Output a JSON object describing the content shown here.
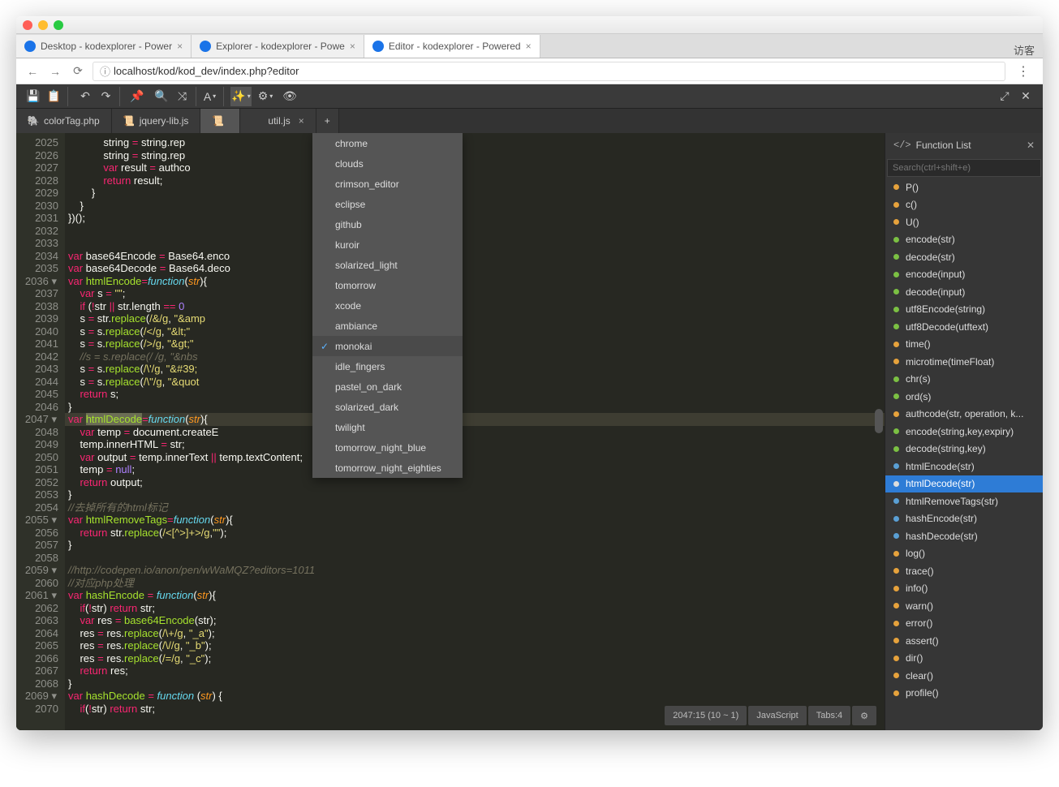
{
  "browser": {
    "tabs": [
      {
        "title": "Desktop - kodexplorer - Power"
      },
      {
        "title": "Explorer - kodexplorer - Powe"
      },
      {
        "title": "Editor - kodexplorer - Powered",
        "active": true
      }
    ],
    "guest": "访客",
    "url": "localhost/kod/kod_dev/index.php?editor"
  },
  "file_tabs": [
    {
      "name": "colorTag.php",
      "icon": "php"
    },
    {
      "name": "jquery-lib.js",
      "icon": "js"
    },
    {
      "name": "",
      "icon": "js",
      "active": true,
      "closable": false
    },
    {
      "name": "util.js",
      "icon": "",
      "closable": true
    }
  ],
  "themes": [
    {
      "name": "chrome"
    },
    {
      "name": "clouds"
    },
    {
      "name": "crimson_editor"
    },
    {
      "name": "eclipse"
    },
    {
      "name": "github"
    },
    {
      "name": "kuroir"
    },
    {
      "name": "solarized_light"
    },
    {
      "name": "tomorrow"
    },
    {
      "name": "xcode"
    },
    {
      "name": "ambiance"
    },
    {
      "name": "monokai",
      "selected": true
    },
    {
      "name": "idle_fingers"
    },
    {
      "name": "pastel_on_dark"
    },
    {
      "name": "solarized_dark"
    },
    {
      "name": "twilight"
    },
    {
      "name": "tomorrow_night_blue"
    },
    {
      "name": "tomorrow_night_eighties"
    }
  ],
  "sidebar": {
    "title": "Function List",
    "search_placeholder": "Search(ctrl+shift+e)",
    "items": [
      {
        "label": "P()",
        "color": "orange"
      },
      {
        "label": "c()",
        "color": "orange"
      },
      {
        "label": "U()",
        "color": "orange"
      },
      {
        "label": "encode(str)",
        "color": "green"
      },
      {
        "label": "decode(str)",
        "color": "green"
      },
      {
        "label": "encode(input)",
        "color": "green"
      },
      {
        "label": "decode(input)",
        "color": "green"
      },
      {
        "label": "utf8Encode(string)",
        "color": "green"
      },
      {
        "label": "utf8Decode(utftext)",
        "color": "green"
      },
      {
        "label": "time()",
        "color": "orange"
      },
      {
        "label": "microtime(timeFloat)",
        "color": "orange"
      },
      {
        "label": "chr(s)",
        "color": "green"
      },
      {
        "label": "ord(s)",
        "color": "green"
      },
      {
        "label": "authcode(str, operation, k...",
        "color": "orange"
      },
      {
        "label": "encode(string,key,expiry)",
        "color": "green"
      },
      {
        "label": "decode(string,key)",
        "color": "green"
      },
      {
        "label": "htmlEncode(str)",
        "color": "blue"
      },
      {
        "label": "htmlDecode(str)",
        "color": "white",
        "selected": true
      },
      {
        "label": "htmlRemoveTags(str)",
        "color": "blue"
      },
      {
        "label": "hashEncode(str)",
        "color": "blue"
      },
      {
        "label": "hashDecode(str)",
        "color": "blue"
      },
      {
        "label": "log()",
        "color": "orange"
      },
      {
        "label": "trace()",
        "color": "orange"
      },
      {
        "label": "info()",
        "color": "orange"
      },
      {
        "label": "warn()",
        "color": "orange"
      },
      {
        "label": "error()",
        "color": "orange"
      },
      {
        "label": "assert()",
        "color": "orange"
      },
      {
        "label": "dir()",
        "color": "orange"
      },
      {
        "label": "clear()",
        "color": "orange"
      },
      {
        "label": "profile()",
        "color": "orange"
      }
    ]
  },
  "status": {
    "pos": "2047:15 (10 ~ 1)",
    "lang": "JavaScript",
    "tabs": "Tabs:4"
  },
  "gutter_start": 2025,
  "gutter_end": 2070,
  "fold_lines": [
    2036,
    2047,
    2055,
    2059,
    2061,
    2069
  ],
  "code_lines": [
    "            string <span class='o'>=</span> string.rep",
    "            string <span class='o'>=</span> string.rep",
    "            <span class='k'>var</span> result <span class='o'>=</span> authco",
    "            <span class='k'>return</span> result;",
    "        }",
    "    }",
    "})();",
    "",
    "",
    "<span class='k'>var</span> base64Encode <span class='o'>=</span> Base64.enco",
    "<span class='k'>var</span> base64Decode <span class='o'>=</span> Base64.deco",
    "<span class='k'>var</span> <span class='fn'>htmlEncode</span><span class='o'>=</span><span class='v'>function</span>(<span class='p'>str</span>){",
    "    <span class='k'>var</span> s <span class='o'>=</span> <span class='s'>\"\"</span>;",
    "    <span class='k'>if</span> (<span class='o'>!</span>str <span class='o'>||</span> str.length <span class='o'>==</span> <span class='n'>0</span>",
    "    s <span class='o'>=</span> str.<span class='fn'>replace</span>(<span class='s'>/&amp;/g</span>, <span class='s'>\"&amp;amp</span>",
    "    s <span class='o'>=</span> s.<span class='fn'>replace</span>(<span class='s'>/&lt;/g</span>, <span class='s'>\"&amp;lt;\"</span>",
    "    s <span class='o'>=</span> s.<span class='fn'>replace</span>(<span class='s'>/&gt;/g</span>, <span class='s'>\"&amp;gt;\"</span>",
    "    <span class='c'>//s = s.replace(/ /g, \"&amp;nbs</span>",
    "    s <span class='o'>=</span> s.<span class='fn'>replace</span>(<span class='s'>/\\'/g</span>, <span class='s'>\"&amp;#39;</span>",
    "    s <span class='o'>=</span> s.<span class='fn'>replace</span>(<span class='s'>/\\\"/g</span>, <span class='s'>\"&amp;quot</span>",
    "    <span class='k'>return</span> s;",
    "}",
    "<span class='k'>var</span> <span class='sel'><span class='fn'>htmlDecode</span></span><span class='o'>=</span><span class='v'>function</span>(<span class='p'>str</span>){",
    "    <span class='k'>var</span> temp <span class='o'>=</span> document.createE",
    "    temp.innerHTML <span class='o'>=</span> str;",
    "    <span class='k'>var</span> output <span class='o'>=</span> temp.innerText <span class='o'>||</span> temp.textContent;",
    "    temp <span class='o'>=</span> <span class='n'>null</span>;",
    "    <span class='k'>return</span> output;",
    "}",
    "<span class='c'>//去掉所有的html标记</span>",
    "<span class='k'>var</span> <span class='fn'>htmlRemoveTags</span><span class='o'>=</span><span class='v'>function</span>(<span class='p'>str</span>){",
    "    <span class='k'>return</span> str.<span class='fn'>replace</span>(<span class='s'>/&lt;[^&gt;]+&gt;/g</span>,<span class='s'>\"\"</span>);",
    "}",
    "",
    "<span class='c'>//http://codepen.io/anon/pen/wWaMQZ?editors=1011</span>",
    "<span class='c'>//对应php处理</span>",
    "<span class='k'>var</span> <span class='fn'>hashEncode</span> <span class='o'>=</span> <span class='v'>function</span>(<span class='p'>str</span>){",
    "    <span class='k'>if</span>(<span class='o'>!</span>str) <span class='k'>return</span> str;",
    "    <span class='k'>var</span> res <span class='o'>=</span> <span class='fn'>base64Encode</span>(str);",
    "    res <span class='o'>=</span> res.<span class='fn'>replace</span>(<span class='s'>/\\+/g</span>, <span class='s'>\"_a\"</span>);",
    "    res <span class='o'>=</span> res.<span class='fn'>replace</span>(<span class='s'>/\\//g</span>, <span class='s'>\"_b\"</span>);",
    "    res <span class='o'>=</span> res.<span class='fn'>replace</span>(<span class='s'>/=/g</span>, <span class='s'>\"_c\"</span>);",
    "    <span class='k'>return</span> res;",
    "}",
    "<span class='k'>var</span> <span class='fn'>hashDecode</span> <span class='o'>=</span> <span class='v'>function</span> (<span class='p'>str</span>) {",
    "    <span class='k'>if</span>(<span class='o'>!</span>str) <span class='k'>return</span> str;"
  ]
}
